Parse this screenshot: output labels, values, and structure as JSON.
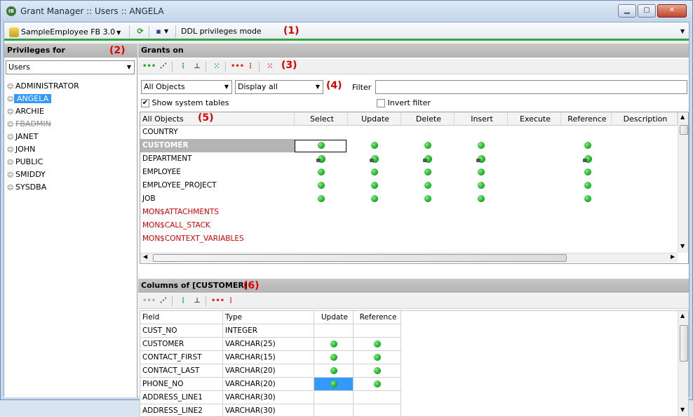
{
  "window": {
    "title": "Grant Manager :: Users :: ANGELA"
  },
  "toolbar": {
    "database": "SampleEmployee FB 3.0",
    "mode_label": "DDL privileges mode",
    "marker": "(1)"
  },
  "privileges_for": {
    "header": "Privileges for",
    "marker": "(2)",
    "type_value": "Users",
    "users": [
      "ADMINISTRATOR",
      "ANGELA",
      "ARCHIE",
      "FBADMIN",
      "JANET",
      "JOHN",
      "PUBLIC",
      "SMIDDY",
      "SYSDBA"
    ],
    "selected": "ANGELA"
  },
  "grants_on": {
    "header": "Grants on",
    "marker3": "(3)",
    "marker4": "(4)",
    "marker5": "(5)",
    "objects_filter": "All Objects",
    "display_filter": "Display all",
    "filter_label": "Filter",
    "show_system_tables": "Show system tables",
    "invert_filter": "Invert filter",
    "columns": [
      "All Objects",
      "Select",
      "Update",
      "Delete",
      "Insert",
      "Execute",
      "Reference",
      "Description"
    ],
    "rows": [
      {
        "name": "COUNTRY",
        "system": false,
        "marks": [
          "",
          "",
          "",
          "",
          "",
          ""
        ]
      },
      {
        "name": "CUSTOMER",
        "system": false,
        "selected": true,
        "marks": [
          "dot",
          "dot",
          "dot",
          "dot",
          "",
          "dot"
        ]
      },
      {
        "name": "DEPARTMENT",
        "system": false,
        "marks": [
          "lock",
          "lock",
          "lock",
          "lock",
          "",
          "lock"
        ]
      },
      {
        "name": "EMPLOYEE",
        "system": false,
        "marks": [
          "dot",
          "dot",
          "dot",
          "dot",
          "",
          "dot"
        ]
      },
      {
        "name": "EMPLOYEE_PROJECT",
        "system": false,
        "marks": [
          "dot",
          "dot",
          "dot",
          "dot",
          "",
          "dot"
        ]
      },
      {
        "name": "JOB",
        "system": false,
        "marks": [
          "dot",
          "dot",
          "dot",
          "dot",
          "",
          "dot"
        ]
      },
      {
        "name": "MON$ATTACHMENTS",
        "system": true,
        "marks": [
          "",
          "",
          "",
          "",
          "",
          ""
        ]
      },
      {
        "name": "MON$CALL_STACK",
        "system": true,
        "marks": [
          "",
          "",
          "",
          "",
          "",
          ""
        ]
      },
      {
        "name": "MON$CONTEXT_VARIABLES",
        "system": true,
        "marks": [
          "",
          "",
          "",
          "",
          "",
          ""
        ]
      }
    ]
  },
  "columns_of": {
    "header": "Columns of [CUSTOMER]",
    "marker": "(6)",
    "columns": [
      "Field",
      "Type",
      "Update",
      "Reference"
    ],
    "rows": [
      {
        "field": "CUST_NO",
        "type": "INTEGER",
        "update": "",
        "reference": ""
      },
      {
        "field": "CUSTOMER",
        "type": "VARCHAR(25)",
        "update": "dot",
        "reference": "dot"
      },
      {
        "field": "CONTACT_FIRST",
        "type": "VARCHAR(15)",
        "update": "dot",
        "reference": "dot"
      },
      {
        "field": "CONTACT_LAST",
        "type": "VARCHAR(20)",
        "update": "dot",
        "reference": "dot"
      },
      {
        "field": "PHONE_NO",
        "type": "VARCHAR(20)",
        "update": "sel",
        "reference": "dot"
      },
      {
        "field": "ADDRESS_LINE1",
        "type": "VARCHAR(30)",
        "update": "",
        "reference": ""
      },
      {
        "field": "ADDRESS_LINE2",
        "type": "VARCHAR(30)",
        "update": "",
        "reference": ""
      }
    ]
  },
  "colors": {
    "accent_green": "#2ea83f",
    "selection": "#3399ff",
    "system_red": "#e00000",
    "grant_green": "#13a31f"
  }
}
